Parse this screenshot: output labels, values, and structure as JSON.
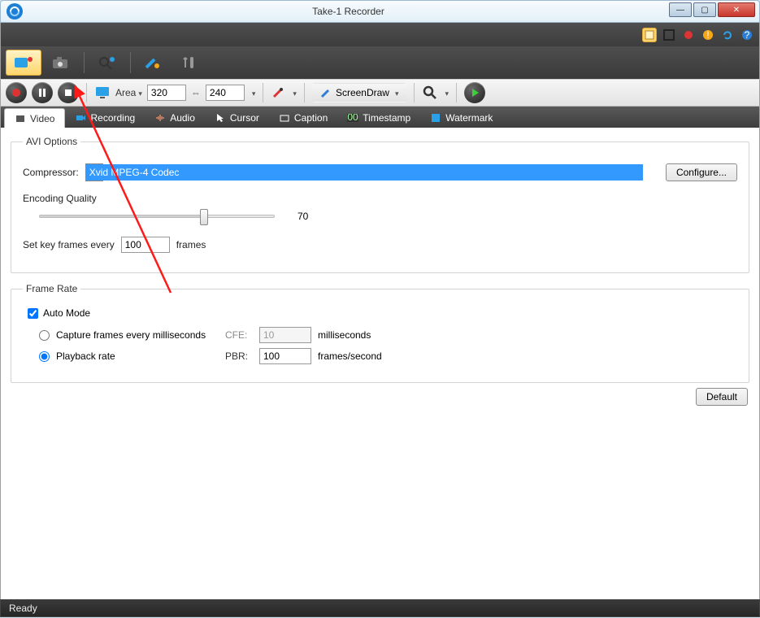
{
  "window": {
    "title": "Take-1 Recorder"
  },
  "ctrlbar": {
    "area_label": "Area",
    "width": "320",
    "height": "240",
    "screendraw": "ScreenDraw"
  },
  "tabs": {
    "video": "Video",
    "recording": "Recording",
    "audio": "Audio",
    "cursor": "Cursor",
    "caption": "Caption",
    "timestamp": "Timestamp",
    "watermark": "Watermark"
  },
  "avi": {
    "legend": "AVI Options",
    "compressor_label": "Compressor:",
    "compressor_value": "Xvid MPEG-4 Codec",
    "configure": "Configure...",
    "encoding_quality_label": "Encoding Quality",
    "encoding_quality_value": "70",
    "keyframes_label": "Set key frames every",
    "keyframes_value": "100",
    "keyframes_unit": "frames"
  },
  "framerate": {
    "legend": "Frame Rate",
    "auto_mode": "Auto Mode",
    "auto_checked": true,
    "cfe_label": "Capture frames every milliseconds",
    "cfe_code": "CFE:",
    "cfe_value": "10",
    "cfe_unit": "milliseconds",
    "pbr_label": "Playback rate",
    "pbr_code": "PBR:",
    "pbr_value": "100",
    "pbr_unit": "frames/second",
    "selected": "pbr"
  },
  "buttons": {
    "default": "Default"
  },
  "status": {
    "text": "Ready"
  }
}
